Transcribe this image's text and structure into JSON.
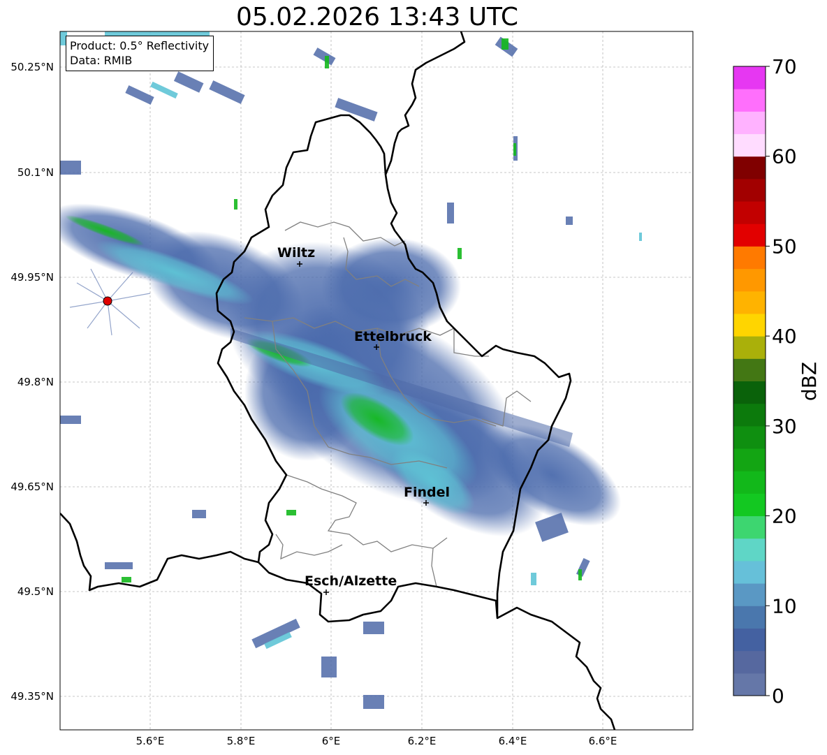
{
  "title": "05.02.2026 13:43 UTC",
  "info": {
    "product_line": "Product: 0.5° Reflectivity",
    "data_line": "Data: RMIB"
  },
  "axes": {
    "lon_ticks": [
      "5.6°E",
      "5.8°E",
      "6°E",
      "6.2°E",
      "6.4°E",
      "6.6°E"
    ],
    "lat_ticks": [
      "50.25°N",
      "50.1°N",
      "49.95°N",
      "49.8°N",
      "49.65°N",
      "49.5°N",
      "49.35°N"
    ]
  },
  "cities": [
    {
      "name": "Wiltz"
    },
    {
      "name": "Ettelbruck"
    },
    {
      "name": "Findel"
    },
    {
      "name": "Esch/Alzette"
    }
  ],
  "radar_site": {
    "color": "#e00000"
  },
  "colorbar": {
    "label": "dBZ",
    "ticks": [
      "0",
      "10",
      "20",
      "30",
      "40",
      "50",
      "60",
      "70"
    ],
    "colors": [
      "#6577a8",
      "#56689f",
      "#4461a1",
      "#4a77ad",
      "#5a98c4",
      "#66c0d9",
      "#5fd6c6",
      "#3dd670",
      "#13c821",
      "#12b81a",
      "#13a513",
      "#0f8f10",
      "#0c7a0c",
      "#0a620a",
      "#437714",
      "#aab00a",
      "#ffd500",
      "#ffb300",
      "#ff9800",
      "#ff7a00",
      "#e20000",
      "#c20000",
      "#a20000",
      "#800000",
      "#ffdcff",
      "#ffb2ff",
      "#ff6ffc",
      "#e637f2"
    ]
  }
}
